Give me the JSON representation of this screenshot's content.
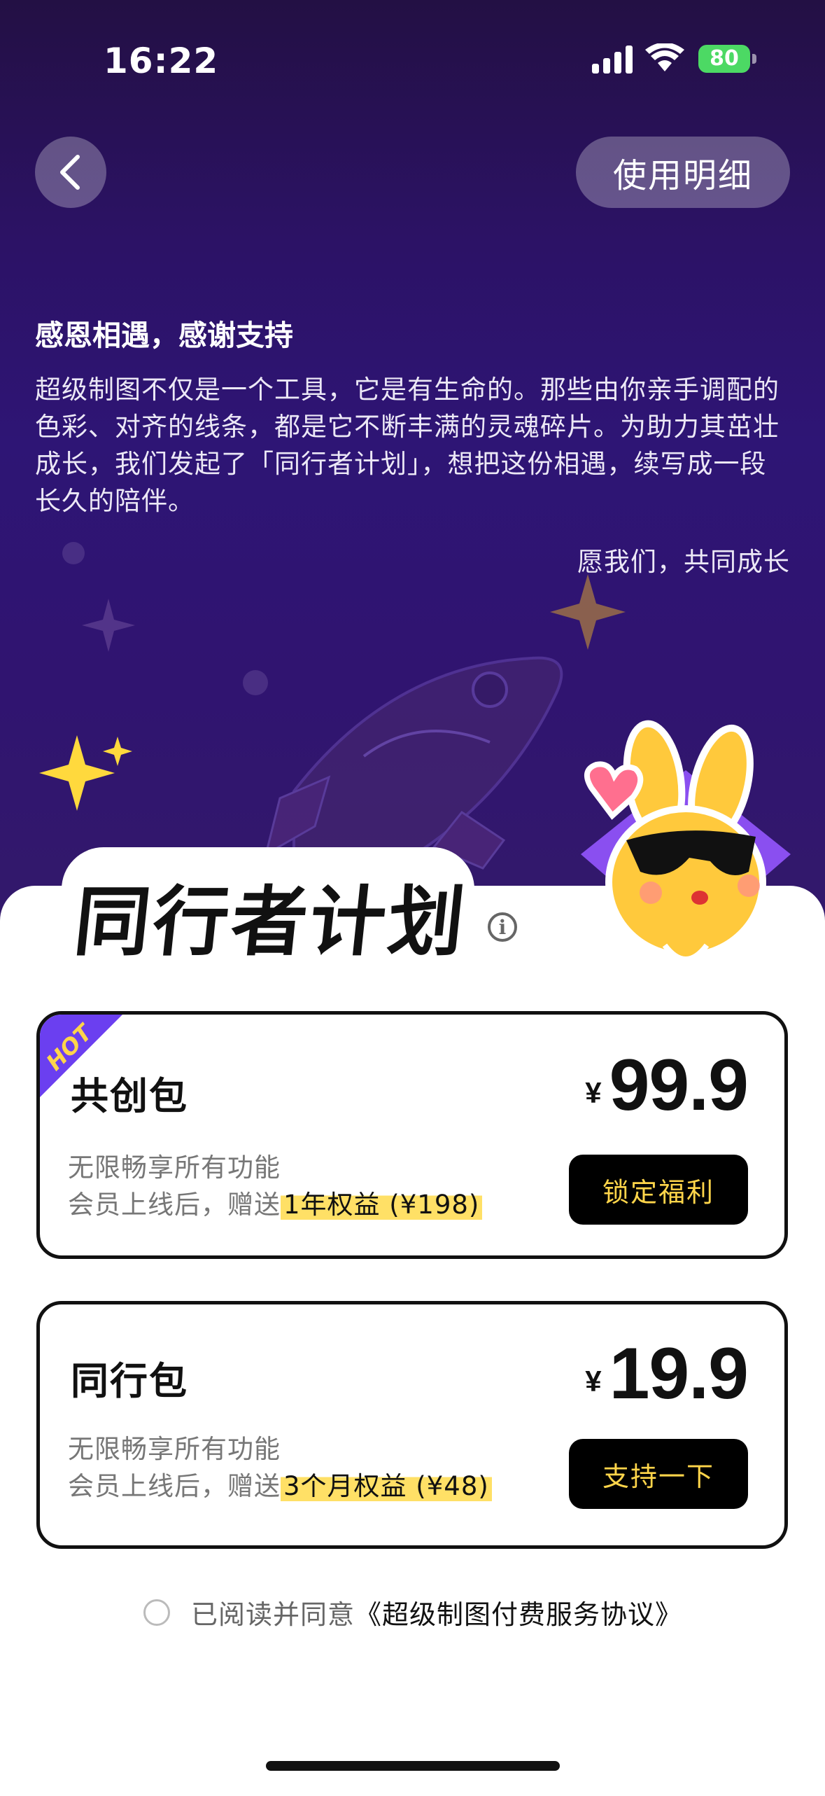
{
  "status_bar": {
    "time": "16:22",
    "battery": "80"
  },
  "header": {
    "back_icon": "chevron-left-icon",
    "detail_button": "使用明细"
  },
  "intro": {
    "title": "感恩相遇，感谢支持",
    "body": "超级制图不仅是一个工具，它是有生命的。那些由你亲手调配的色彩、对齐的线条，都是它不断丰满的灵魂碎片。为助力其茁壮成长，我们发起了「同行者计划」，想把这份相遇，续写成一段长久的陪伴。",
    "signature": "愿我们，共同成长"
  },
  "plan": {
    "title": "同行者计划",
    "info_icon": "info-icon"
  },
  "cards": [
    {
      "badge": "HOT",
      "name": "共创包",
      "currency": "¥",
      "price": "99.9",
      "desc_line1": "无限畅享所有功能",
      "desc_line2_prefix": "会员上线后，赠送",
      "desc_highlight": "1年权益 (¥198)",
      "button": "锁定福利"
    },
    {
      "name": "同行包",
      "currency": "¥",
      "price": "19.9",
      "desc_line1": "无限畅享所有功能",
      "desc_line2_prefix": "会员上线后，赠送",
      "desc_highlight": "3个月权益 (¥48)",
      "button": "支持一下"
    }
  ],
  "agreement": {
    "prefix": "已阅读并同意",
    "link": "《超级制图付费服务协议》",
    "checked": false
  },
  "colors": {
    "hero_bg": "#2e1575",
    "button_text": "#ffd54a",
    "highlight": "#ffe066",
    "hot_badge": "#6b3ff0"
  }
}
